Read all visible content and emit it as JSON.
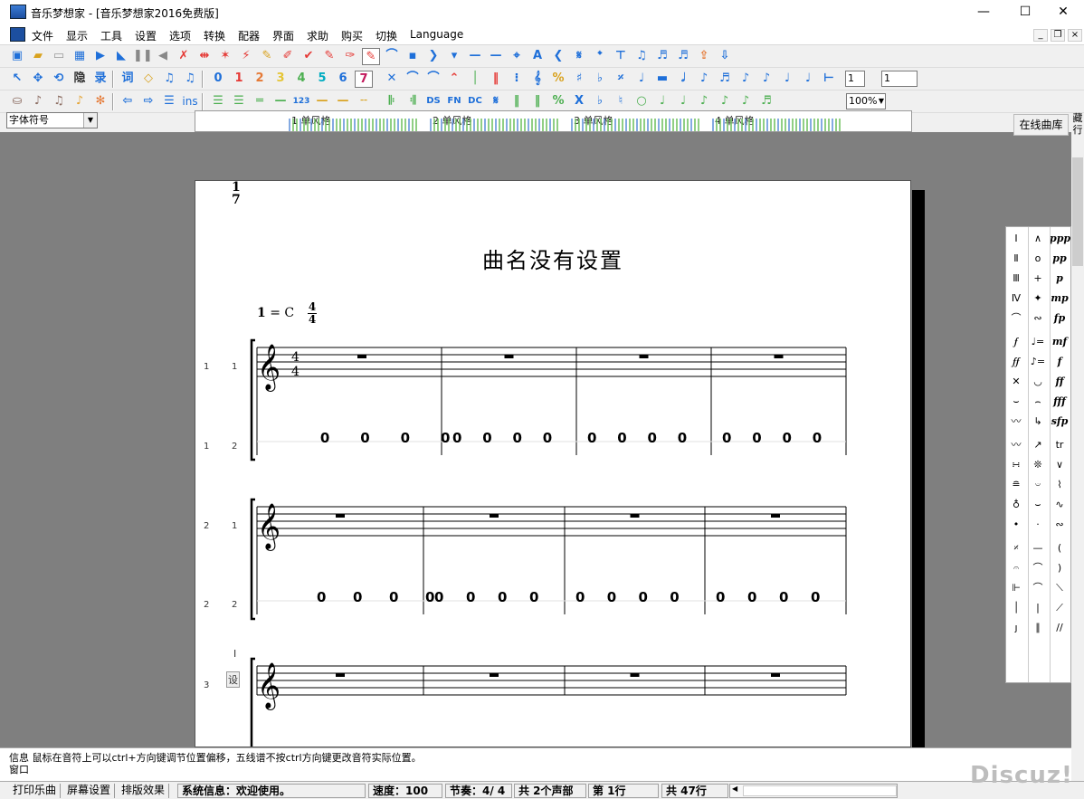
{
  "window": {
    "title": "音乐梦想家 - [音乐梦想家2016免费版]",
    "minimize": "—",
    "maximize": "☐",
    "close": "✕"
  },
  "menu": [
    "文件",
    "显示",
    "工具",
    "设置",
    "选项",
    "转换",
    "配器",
    "界面",
    "求助",
    "购买",
    "切换",
    "Language"
  ],
  "mdi_controls": [
    "_",
    "❐",
    "×"
  ],
  "toolbar3": {
    "ins_label": "ins",
    "zoom": "100%"
  },
  "toolbar1_inputs": {
    "value_a": "1",
    "value_b": "1"
  },
  "font_select": "字体符号",
  "online_library": "在线曲库",
  "side_vertical_text": [
    "藏",
    "行"
  ],
  "overview": {
    "measures": [
      "1 单风格",
      "2 单风格",
      "3 单风格",
      "4 单风格"
    ]
  },
  "score": {
    "title": "曲名没有设置",
    "key": "1",
    "key_equals": "= C",
    "time_top": "4",
    "time_bottom": "4",
    "staff_time_top": "4",
    "staff_time_bottom": "4",
    "corner_mark_top": "1",
    "corner_mark_bottom": "7",
    "num_notes_row1": [
      "0",
      "0",
      "0",
      "0",
      "0",
      "0",
      "0",
      "0",
      "0",
      "0",
      "0",
      "0",
      "0",
      "0",
      "0",
      "0"
    ],
    "num_notes_row2": [
      "0",
      "0",
      "0",
      "0",
      "0",
      "0",
      "0",
      "0",
      "0",
      "0",
      "0",
      "0",
      "0",
      "0",
      "0",
      "0"
    ],
    "system_labels": [
      {
        "a": "1",
        "b": "1"
      },
      {
        "a": "1",
        "b": "2"
      },
      {
        "a": "2",
        "b": "1"
      },
      {
        "a": "2",
        "b": "2"
      },
      {
        "a": "3",
        "b": "设"
      }
    ],
    "cursor_mark": "I"
  },
  "palette": {
    "col1": [
      "Ⅰ",
      "Ⅱ",
      "Ⅲ",
      "Ⅳ",
      "⌒",
      "𝆑",
      "𝆑𝆑",
      "✕",
      "⌣",
      "〰",
      "〰",
      "∺",
      "≘",
      "♁",
      "•",
      "𝄎",
      "𝄐",
      "⊩",
      "│",
      "ȷ"
    ],
    "col2": [
      "∧",
      "o",
      "+",
      "✦",
      "∾",
      "♩=",
      "♪=",
      "◡",
      "⌢",
      "↳",
      "↗",
      "❊",
      "𝄑",
      "⌣",
      "·",
      "—",
      "⌒",
      "⌒",
      "|",
      "∥"
    ],
    "col3": [
      "ppp",
      "pp",
      "p",
      "mp",
      "fp",
      "mf",
      "f",
      "ff",
      "fff",
      "sfp",
      "tr",
      "∨",
      "⌇",
      "∿",
      "∾",
      "(",
      ")",
      "⟍",
      "⟋",
      "//"
    ]
  },
  "info": {
    "line1": "信息  鼠标在音符上可以ctrl+方向键调节位置偏移，五线谱不按ctrl方向键更改音符实际位置。",
    "line2": "窗口"
  },
  "status": {
    "print": "打印乐曲",
    "screen": "屏幕设置",
    "layout": "排版效果",
    "system_info": "系统信息：欢迎使用。",
    "tempo": "速度：100",
    "beat": "节奏：4/ 4",
    "voices": "共 2个声部",
    "line": "第 1行",
    "total_lines": "共 47行"
  },
  "watermark": "Discuz!",
  "colors": {
    "workspace": "#7f7f7f",
    "accent_red": "#e53935",
    "accent_blue": "#1e6fd9"
  }
}
